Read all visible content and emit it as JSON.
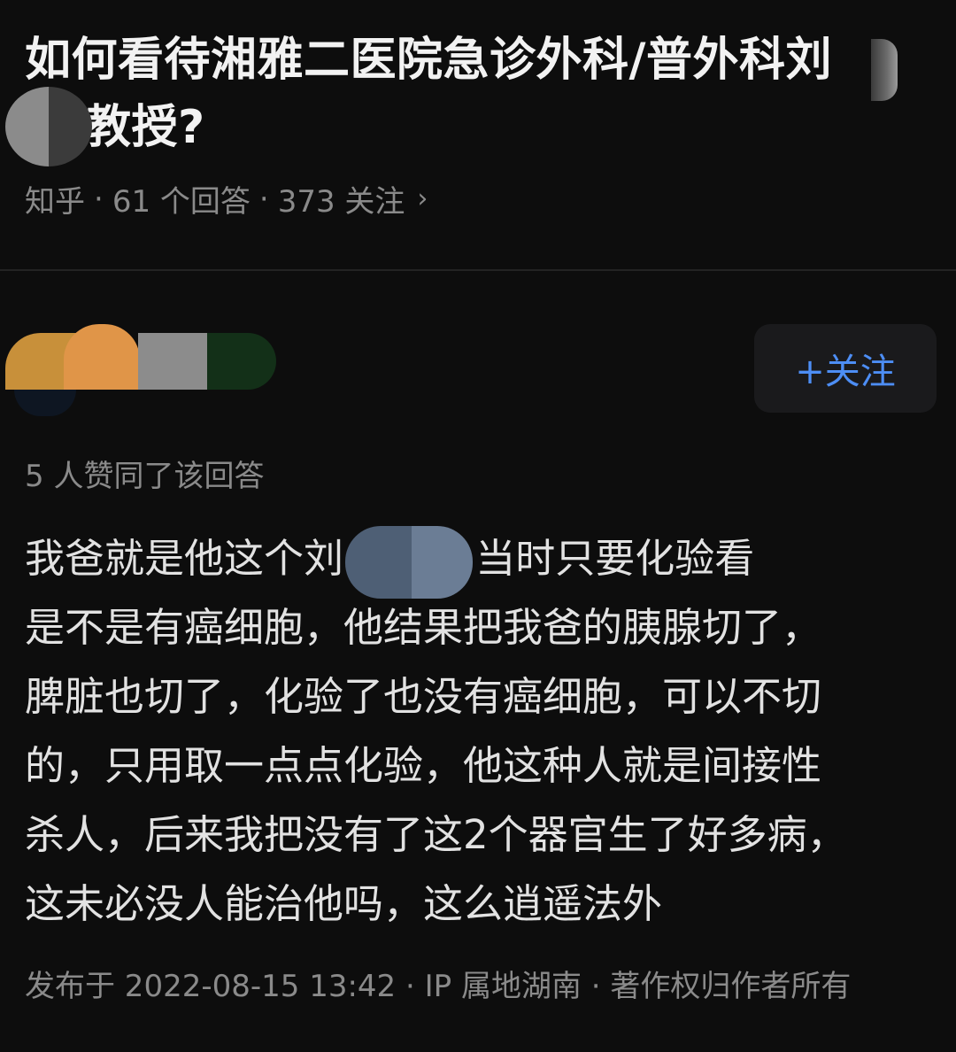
{
  "question": {
    "title": "如何看待湘雅二医院急诊外科/普外科刘教授?",
    "title_line1": "如何看待湘雅二医院急诊外科/普外科刘",
    "title_line2": "教授?",
    "source": "知乎",
    "answers": "61 个回答",
    "follows": "373 关注",
    "separator": "·",
    "chevron": "›"
  },
  "author": {
    "follow_label": "+关注"
  },
  "answer": {
    "votes": "5 人赞同了该回答",
    "lines": [
      "我爸就是他这个刘  做的，当时只要化验看",
      "是不是有癌细胞，他结果把我爸的胰腺切了，",
      "脾脏也切了，化验了也没有癌细胞，可以不切",
      "的，只用取一点点化验，他这种人就是间接性",
      "杀人，后来我把没有了这2个器官生了好多病，",
      "这未必没人能治他吗，这么逍遥法外"
    ],
    "footer": "发布于 2022-08-15 13:42 · IP 属地湖南 · 著作权归作者所有"
  },
  "colors": {
    "background": "#0d0d0d",
    "text": "#e2e2e2",
    "muted": "#8a8a8a",
    "accent": "#4d8ef5"
  }
}
